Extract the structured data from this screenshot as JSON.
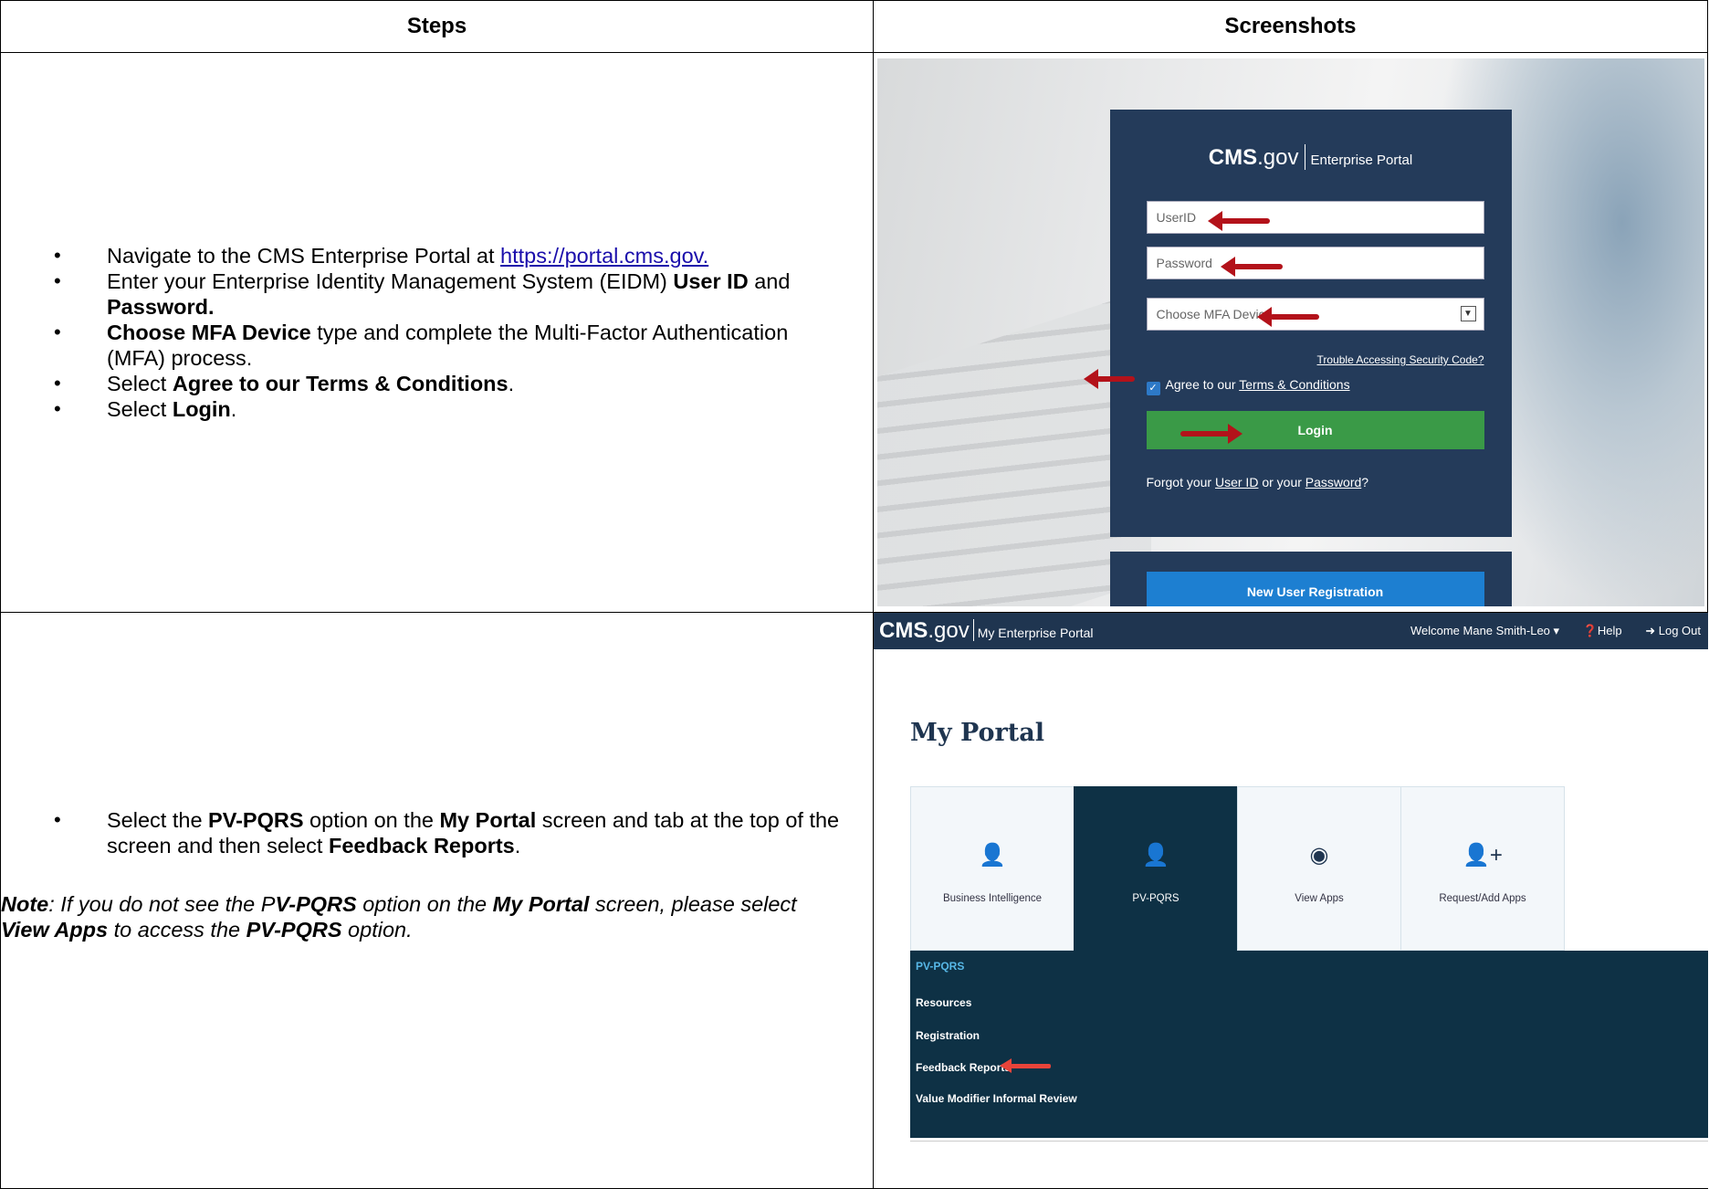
{
  "headers": {
    "steps": "Steps",
    "screenshots": "Screenshots"
  },
  "row1": {
    "link": "https://portal.cms.gov. ",
    "b1_pre": "Navigate to the CMS Enterprise Portal at ",
    "b2_pre": "Enter your Enterprise Identity Management System (EIDM) ",
    "b2_bold1": "User ID",
    "b2_mid": " and ",
    "b2_bold2": "Password.",
    "b3_bold": "Choose MFA Device",
    "b3_rest": " type and complete the Multi-Factor Authentication (MFA) process.",
    "b4_pre": "Select ",
    "b4_bold": "Agree to our Terms & Conditions",
    "b4_post": ".",
    "b5_pre": "Select ",
    "b5_bold": "Login",
    "b5_post": "."
  },
  "login_screen": {
    "brand_cms": "CMS",
    "brand_gov": ".gov",
    "brand_portal": "Enterprise Portal",
    "userid_placeholder": "UserID",
    "password_placeholder": "Password",
    "mfa_placeholder": "Choose MFA Device",
    "trouble_link": "Trouble Accessing Security Code?",
    "agree_pre": "Agree to our ",
    "agree_link": "Terms & Conditions",
    "login_button": "Login",
    "forgot_pre": "Forgot your ",
    "forgot_userid": "User ID",
    "forgot_mid": " or your ",
    "forgot_password": "Password",
    "forgot_post": "?",
    "new_user_button": "New User Registration"
  },
  "row2": {
    "b1_pre": "Select the ",
    "b1_bold1": "PV-PQRS",
    "b1_mid1": " option on the ",
    "b1_bold2": "My Portal",
    "b1_mid2": " screen and tab at the top of the screen and then select ",
    "b1_bold3": "Feedback Reports",
    "b1_post": ".",
    "note_label": "Note",
    "note_1": ": If you do not see the P",
    "note_b1": "V-PQRS",
    "note_2": " option on the ",
    "note_b2": "My Portal",
    "note_3": " screen, please select ",
    "note_b3": "View Apps",
    "note_4": " to access the ",
    "note_b4": "PV-PQRS",
    "note_5": " option."
  },
  "portal_screen": {
    "logo_cms": "CMS",
    "logo_gov": ".gov",
    "logo_sub": "My Enterprise Portal",
    "welcome": "Welcome Mane Smith-Leo ▾",
    "help": "❓Help",
    "logout": "➜ Log Out",
    "title": "My Portal",
    "tiles": [
      "Business Intelligence",
      "PV-PQRS",
      "View Apps",
      "Request/Add Apps"
    ],
    "menu_header": "PV-PQRS",
    "menu_items": [
      "Resources",
      "Registration",
      "Feedback Reports",
      "Value Modifier Informal Review"
    ]
  }
}
